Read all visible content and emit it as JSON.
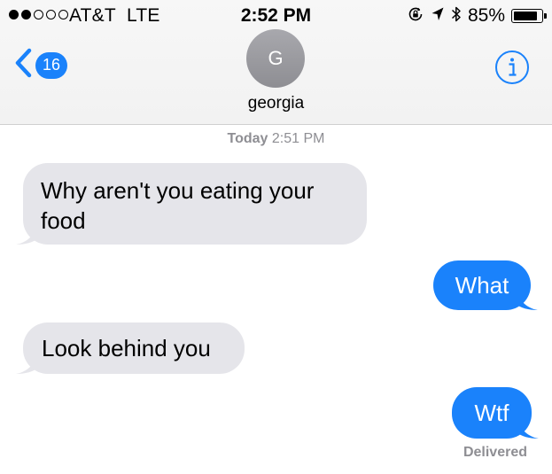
{
  "status_bar": {
    "signal_dots_filled": 2,
    "signal_dots_total": 5,
    "carrier": "AT&T",
    "network": "LTE",
    "time": "2:52 PM",
    "battery_percent": "85%",
    "battery_level": 0.85,
    "icons": [
      "rotation-lock-icon",
      "location-arrow-icon",
      "bluetooth-icon",
      "battery-icon"
    ]
  },
  "nav": {
    "back_badge": "16",
    "avatar_initial": "G",
    "contact_name": "georgia",
    "info_icon": "info-icon"
  },
  "conversation": {
    "timestamp_day": "Today",
    "timestamp_time": "2:51 PM",
    "messages": [
      {
        "direction": "incoming",
        "text": "Why aren't you eating your food"
      },
      {
        "direction": "outgoing",
        "text": "What"
      },
      {
        "direction": "incoming",
        "text": "Look behind you"
      },
      {
        "direction": "outgoing",
        "text": "Wtf"
      }
    ],
    "status": "Delivered"
  },
  "colors": {
    "accent_blue": "#1a82fb",
    "incoming_bubble": "#e5e5ea",
    "secondary_text": "#8e8e93"
  }
}
